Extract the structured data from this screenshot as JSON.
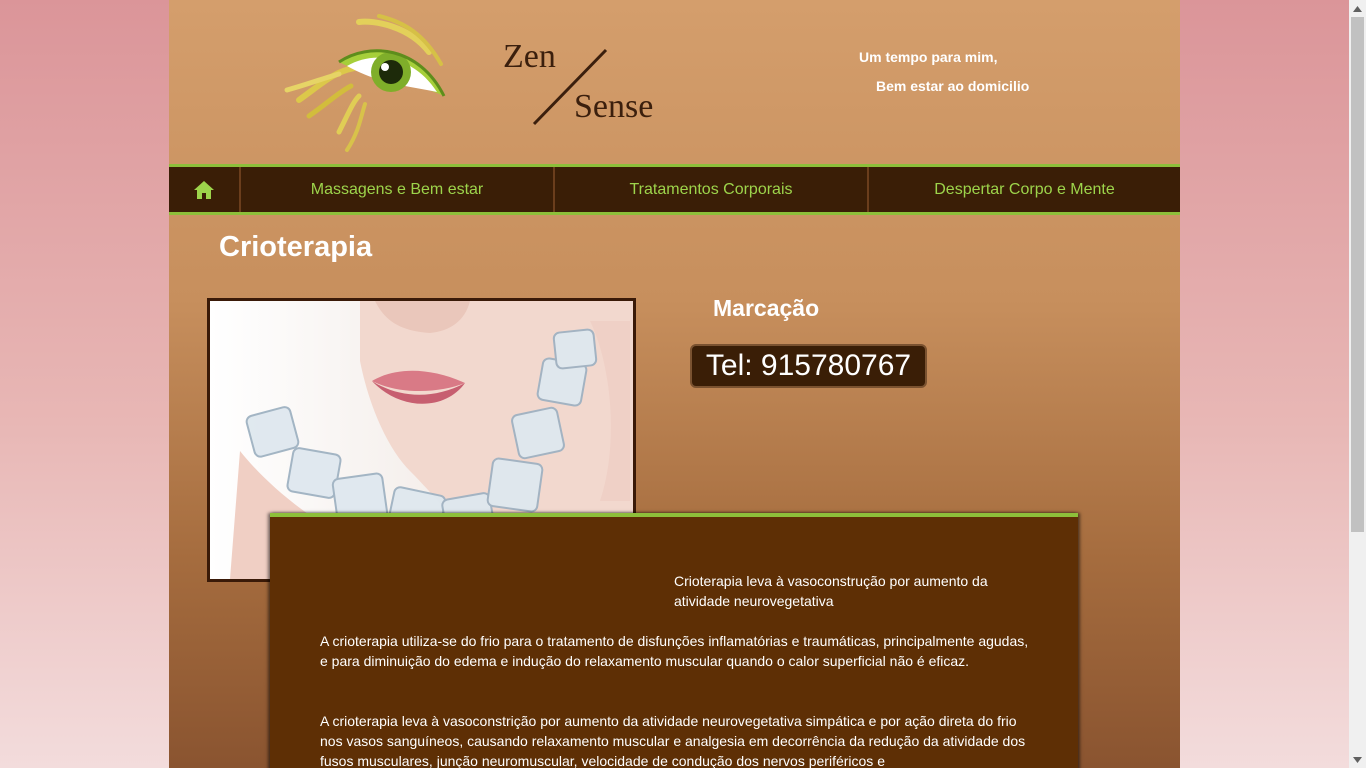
{
  "header": {
    "logo_icon": "eye-logo-icon",
    "logo_word_1": "Zen",
    "logo_word_2": "Sense",
    "tagline_1": "Um tempo para mim,",
    "tagline_2": "Bem estar ao domicilio"
  },
  "nav": {
    "home_icon": "home-icon",
    "items": [
      {
        "label": "Massagens e Bem estar"
      },
      {
        "label": "Tratamentos Corporais"
      },
      {
        "label": "Despertar Corpo e Mente"
      }
    ]
  },
  "main": {
    "title": "Crioterapia",
    "booking_title": "Marcação",
    "phone": "Tel: 915780767",
    "intro": "Crioterapia leva à vasoconstrução por aumento da atividade neurovegetativa",
    "paragraphs": [
      "A crioterapia utiliza-se do frio para o tratamento de disfunções inflamatórias e traumáticas, principalmente agudas, e para diminuição do edema e indução do relaxamento muscular quando o calor superficial não é eficaz.",
      "A crioterapia leva à vasoconstrição por aumento da atividade neurovegetativa simpática e por ação direta do frio nos vasos sanguíneos, causando relaxamento muscular e analgesia em decorrência da redução da atividade dos fusos musculares, junção neuromuscular, velocidade de condução dos nervos periféricos e"
    ]
  },
  "colors": {
    "nav_bg": "#3a1e06",
    "nav_text": "#9dd44b",
    "accent_green": "#8dbf3a",
    "content_bg": "#5e2f05"
  }
}
